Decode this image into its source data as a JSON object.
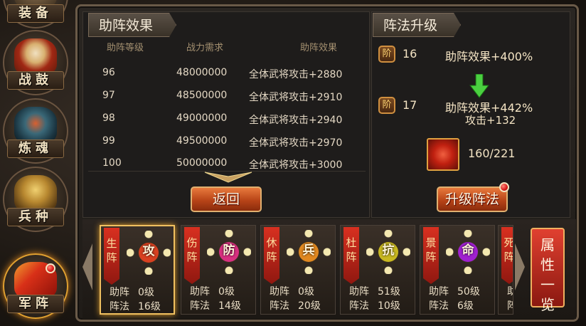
{
  "sidebar": {
    "items": [
      {
        "label": "装备",
        "name": "equipment"
      },
      {
        "label": "战鼓",
        "name": "war-drum"
      },
      {
        "label": "炼魂",
        "name": "soul-refine"
      },
      {
        "label": "兵种",
        "name": "troop-type"
      },
      {
        "label": "军阵",
        "name": "formation"
      }
    ]
  },
  "support": {
    "title": "助阵效果",
    "headers": [
      "助阵等级",
      "战力需求",
      "助阵效果"
    ],
    "rows": [
      {
        "level": "96",
        "power": "48000000",
        "effect": "全体武将攻击+2880"
      },
      {
        "level": "97",
        "power": "48500000",
        "effect": "全体武将攻击+2910"
      },
      {
        "level": "98",
        "power": "49000000",
        "effect": "全体武将攻击+2940"
      },
      {
        "level": "99",
        "power": "49500000",
        "effect": "全体武将攻击+2970"
      },
      {
        "level": "100",
        "power": "50000000",
        "effect": "全体武将攻击+3000"
      }
    ],
    "back_label": "返回"
  },
  "upgrade": {
    "title": "阵法升级",
    "tier_badge": "阶",
    "current": {
      "tier": "16",
      "effect": "助阵效果+400%"
    },
    "next": {
      "tier": "17",
      "effect": "助阵效果+442%",
      "extra": "攻击+132"
    },
    "material": {
      "count": "160/221"
    },
    "button_label": "升级阵法"
  },
  "formations": [
    {
      "flag": "生阵",
      "glyph": "攻",
      "support": "0级",
      "array": "16级",
      "core": "#d84020"
    },
    {
      "flag": "伤阵",
      "glyph": "防",
      "support": "0级",
      "array": "14级",
      "core": "#d83080"
    },
    {
      "flag": "休阵",
      "glyph": "兵",
      "support": "0级",
      "array": "20级",
      "core": "#e08820"
    },
    {
      "flag": "杜阵",
      "glyph": "抗",
      "support": "51级",
      "array": "10级",
      "core": "#c8b820"
    },
    {
      "flag": "景阵",
      "glyph": "命",
      "support": "50级",
      "array": "6级",
      "core": "#a020d0"
    },
    {
      "flag": "死阵",
      "glyph": "",
      "support": "",
      "array": "",
      "core": "#d84020"
    }
  ],
  "labels": {
    "support": "助阵",
    "array": "阵法"
  },
  "attributes_button": "属性一览"
}
